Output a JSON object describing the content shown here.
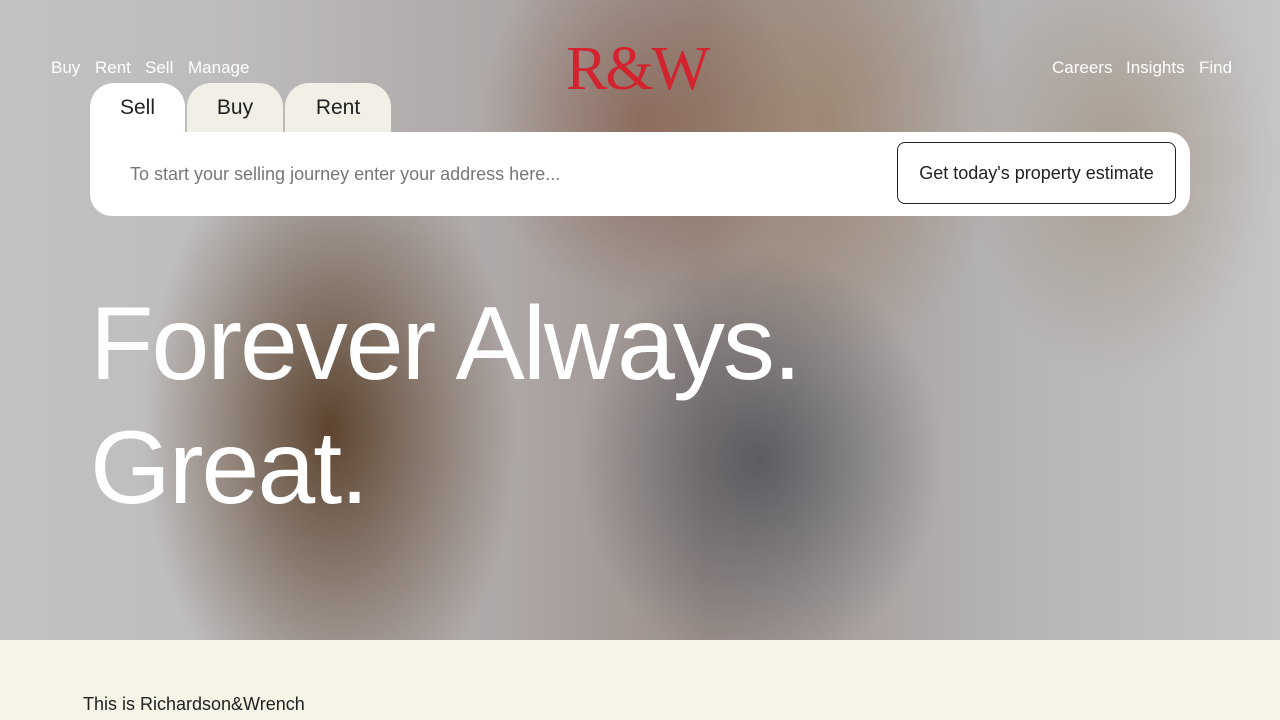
{
  "nav": {
    "left": [
      "Buy",
      "Rent",
      "Sell",
      "Manage"
    ],
    "right": [
      "Careers",
      "Insights",
      "Find"
    ]
  },
  "logo": {
    "text": "R&W"
  },
  "tabs": [
    {
      "label": "Sell",
      "active": true
    },
    {
      "label": "Buy",
      "active": false
    },
    {
      "label": "Rent",
      "active": false
    }
  ],
  "search": {
    "placeholder": "To start your selling journey enter your address here...",
    "value": "",
    "button_label": "Get today's property estimate"
  },
  "hero": {
    "line1": "Forever Always.",
    "line2": "Great."
  },
  "intro": {
    "text": "This is Richardson&Wrench"
  },
  "colors": {
    "brand": "#d2232e",
    "cream": "#f6f3e7"
  }
}
